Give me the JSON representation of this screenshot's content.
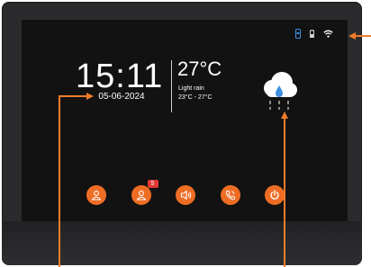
{
  "status_icons": [
    "phone-signal-icon",
    "battery-icon",
    "wifi-icon"
  ],
  "clock": {
    "time": "15:11",
    "date": "05-06-2024"
  },
  "weather": {
    "temperature": "27°C",
    "description": "Light rain",
    "range": "23°C - 27°C",
    "icon": "rain-cloud-icon"
  },
  "dock": {
    "items": [
      {
        "name": "contact",
        "icon": "person-icon"
      },
      {
        "name": "messages",
        "icon": "person-icon",
        "badge": "5"
      },
      {
        "name": "volume",
        "icon": "speaker-icon"
      },
      {
        "name": "call-history",
        "icon": "phone-icon"
      },
      {
        "name": "power",
        "icon": "power-icon"
      }
    ]
  },
  "colors": {
    "accent": "#ee6d24",
    "annotation": "#f07c2a",
    "screen": "#121212",
    "bezel": "#2b2b2d",
    "badge": "#e53935",
    "signal": "#3f8fe0"
  }
}
